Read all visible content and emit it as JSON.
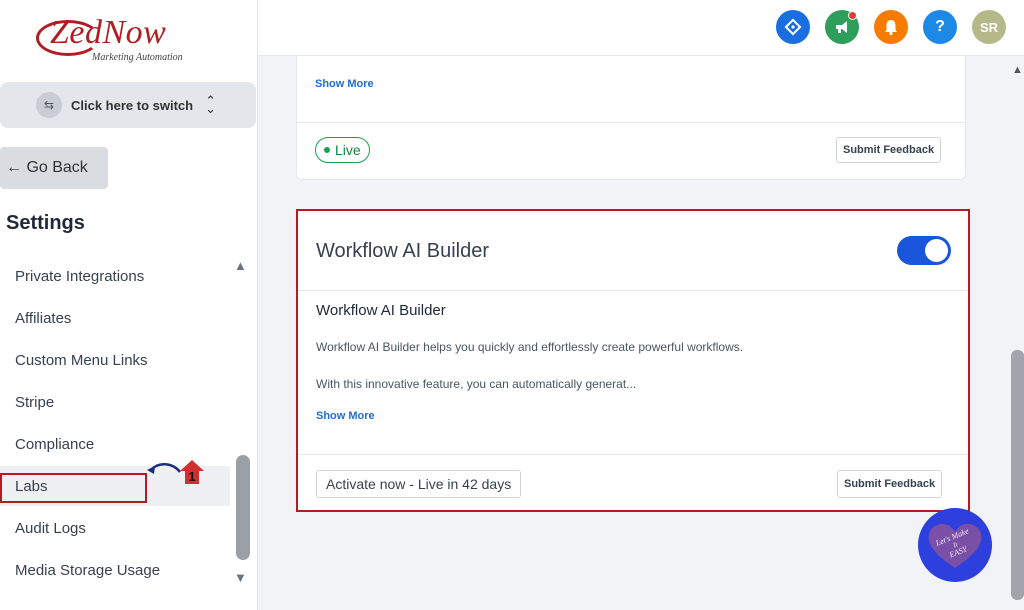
{
  "logo": {
    "main": "ZedNow",
    "tagline": "Marketing Automation"
  },
  "switcher": {
    "label": "Click here to switch"
  },
  "go_back": {
    "label": "← Go Back"
  },
  "settings": {
    "title": "Settings"
  },
  "menu": {
    "items": [
      {
        "label": "Private Integrations"
      },
      {
        "label": "Affiliates"
      },
      {
        "label": "Custom Menu Links"
      },
      {
        "label": "Stripe"
      },
      {
        "label": "Compliance"
      },
      {
        "label": "Labs"
      },
      {
        "label": "Audit Logs"
      },
      {
        "label": "Media Storage Usage"
      }
    ]
  },
  "annotation": {
    "badge": "1"
  },
  "topbar": {
    "icons": [
      {
        "name": "diamond-icon",
        "color": "#1a6fe0"
      },
      {
        "name": "megaphone-icon",
        "color": "#2e9e5b"
      },
      {
        "name": "bell-icon",
        "color": "#f57c00"
      },
      {
        "name": "help-icon",
        "color": "#1e88e5"
      },
      {
        "name": "avatar",
        "color": "#b5b98a"
      }
    ],
    "avatar_initials": "SR",
    "help_glyph": "?"
  },
  "card1": {
    "show_more": "Show More",
    "status": "Live",
    "feedback": "Submit Feedback"
  },
  "card2": {
    "title": "Workflow AI Builder",
    "enabled": true,
    "subtitle": "Workflow AI Builder",
    "desc1": "Workflow AI Builder helps you quickly and effortlessly create powerful workflows.",
    "desc2": "With this innovative feature, you can automatically generat...",
    "show_more": "Show More",
    "activate": "Activate now - Live in 42 days",
    "feedback": "Submit Feedback"
  },
  "easy_badge": {
    "line1": "Let's Make",
    "line2": "It",
    "line3": "EASY"
  }
}
